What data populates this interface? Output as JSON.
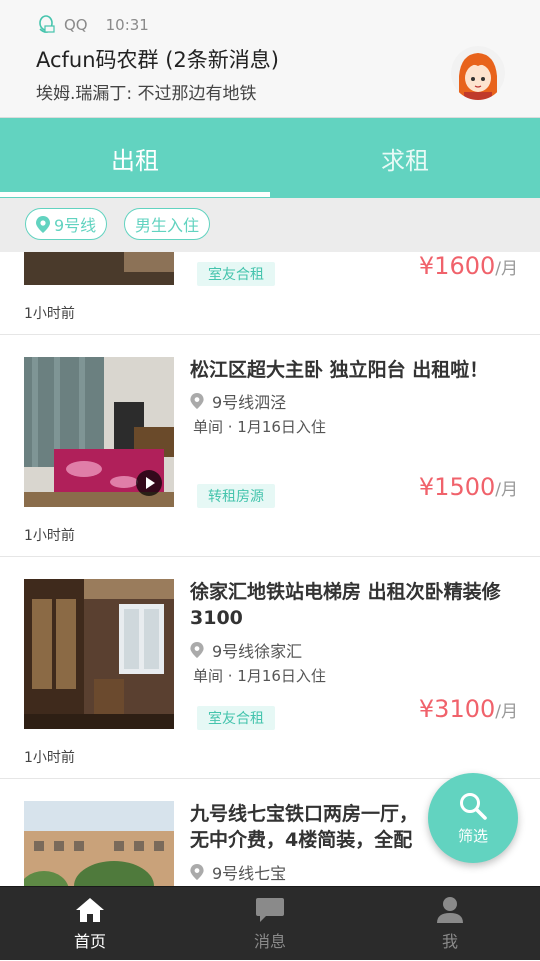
{
  "notification": {
    "app_name": "QQ",
    "time": "10:31",
    "title": "Acfun码农群 (2条新消息)",
    "text": "埃姆.瑞漏丁: 不过那边有地铁"
  },
  "tabs": [
    {
      "label": "出租",
      "active": true
    },
    {
      "label": "求租",
      "active": false
    }
  ],
  "filters": {
    "line": "9号线",
    "gender": "男生入住"
  },
  "listings": [
    {
      "title": "",
      "location": "",
      "meta": "",
      "tag": "室友合租",
      "price": "¥1600",
      "unit": "/月",
      "time": "1小时前"
    },
    {
      "title": "松江区超大主卧 独立阳台 出租啦！",
      "location": "9号线泗泾",
      "meta": "单间 · 1月16日入住",
      "tag": "转租房源",
      "price": "¥1500",
      "unit": "/月",
      "time": "1小时前"
    },
    {
      "title": "徐家汇地铁站电梯房 出租次卧精装修3100",
      "location": "9号线徐家汇",
      "meta": "单间 · 1月16日入住",
      "tag": "室友合租",
      "price": "¥3100",
      "unit": "/月",
      "time": "1小时前"
    },
    {
      "title": "九号线七宝铁口两房一厅，无中介费，4楼简装，全配",
      "location": "9号线七宝",
      "meta": "",
      "tag": "",
      "price": "",
      "unit": "",
      "time": ""
    }
  ],
  "fab": {
    "label": "筛选",
    "icon": "search-icon"
  },
  "bottom_nav": [
    {
      "label": "首页",
      "icon": "home-icon",
      "active": true
    },
    {
      "label": "消息",
      "icon": "message-icon",
      "active": false
    },
    {
      "label": "我",
      "icon": "profile-icon",
      "active": false
    }
  ],
  "colors": {
    "accent": "#62d3c0",
    "price": "#f0626b",
    "tag_bg": "#e6f8f5",
    "nav_bg": "#2b2b2b"
  }
}
